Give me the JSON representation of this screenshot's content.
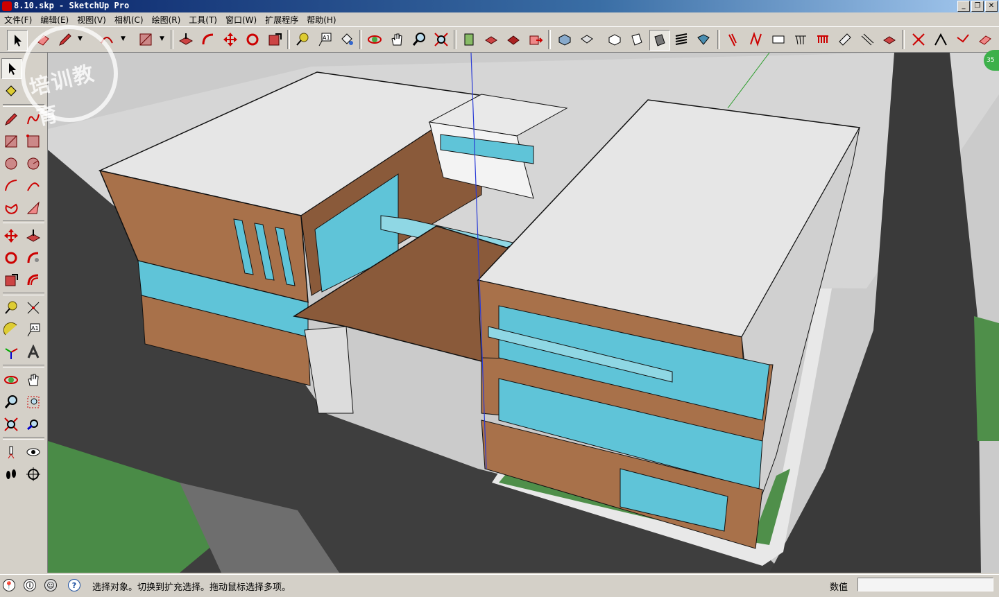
{
  "window": {
    "title": "8.10.skp - SketchUp Pro"
  },
  "window_buttons": {
    "minimize": "_",
    "restore": "❐",
    "close": "✕"
  },
  "menu": [
    {
      "label": "文件(F)"
    },
    {
      "label": "编辑(E)"
    },
    {
      "label": "视图(V)"
    },
    {
      "label": "相机(C)"
    },
    {
      "label": "绘图(R)"
    },
    {
      "label": "工具(T)"
    },
    {
      "label": "窗口(W)"
    },
    {
      "label": "扩展程序"
    },
    {
      "label": "帮助(H)"
    }
  ],
  "toolbar_icons": [
    "select",
    "eraser",
    "pencil",
    "arc",
    "rectangle",
    "push-pull",
    "follow-me",
    "move",
    "rotate",
    "scale",
    "tape-measure",
    "text",
    "paint-bucket",
    "orbit",
    "pan",
    "zoom",
    "zoom-extents",
    "warehouse",
    "components",
    "extension-warehouse",
    "send-to-layout",
    "iso",
    "top",
    "front",
    "right",
    "back",
    "left",
    "x-ray",
    "back-edges",
    "wireframe",
    "hidden-line",
    "shaded",
    "shaded-textures",
    "monochrome",
    "sandbox-contours",
    "sandbox-scratch",
    "smoove",
    "stamp",
    "drape",
    "add-detail",
    "flip-edge",
    "section-plane",
    "section-cut",
    "section-fill"
  ],
  "left_icons": [
    "select",
    "paint",
    "pencil",
    "freehand",
    "rectangle",
    "rotated-rect",
    "circle",
    "polygon",
    "arc",
    "arc-2pt",
    "pie",
    "arc-3pt",
    "move",
    "push-pull",
    "rotate",
    "follow-me",
    "scale",
    "offset",
    "tape-measure",
    "dimension",
    "protractor",
    "text",
    "axes",
    "3d-text",
    "orbit",
    "pan",
    "zoom",
    "zoom-window",
    "zoom-extents",
    "previous-view",
    "position-camera",
    "look-around",
    "walk",
    "section-plane"
  ],
  "status": {
    "text": "选择对象。切换到扩充选择。拖动鼠标选择多项。",
    "value_label": "数值",
    "value": "",
    "icons": [
      "geo-location",
      "credits",
      "user",
      "help"
    ],
    "help_glyph": "?",
    "credits_glyph": "ⓘ"
  },
  "watermark": {
    "text": "培训教育"
  },
  "badge": {
    "text": "35"
  },
  "colors": {
    "accent": "#0a246a",
    "brown_wall": "#a8714a",
    "glass": "#5fc4d8",
    "roof": "#e4e4e4",
    "road": "#3d3d3d",
    "grass": "#4f8f4a",
    "ground": "#d0d0d0"
  }
}
